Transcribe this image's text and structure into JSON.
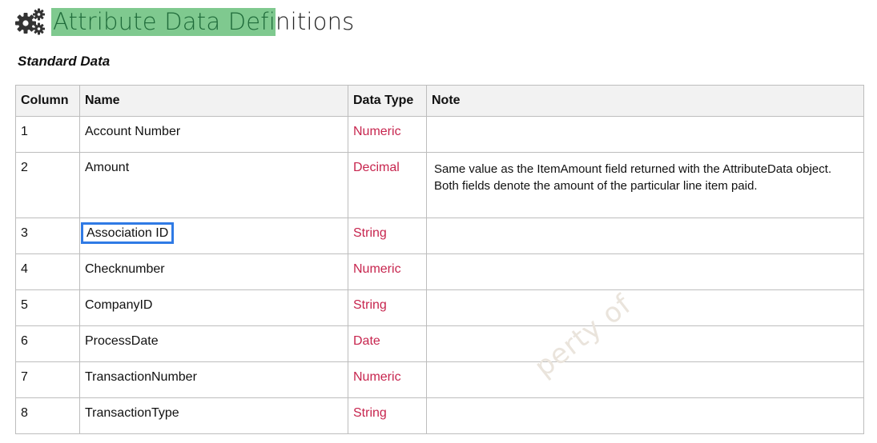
{
  "header": {
    "icon": "gears-icon",
    "title_highlight": "Attribute Data Defi",
    "title_rest": "nitions",
    "highlight_color": "#7fc98f"
  },
  "section": {
    "heading": "Standard Data"
  },
  "table": {
    "headers": {
      "column": "Column",
      "name": "Name",
      "data_type": "Data Type",
      "note": "Note"
    },
    "type_color": "#c7254e",
    "rows": [
      {
        "column": "1",
        "name": "Account Number",
        "data_type": "Numeric",
        "note": ""
      },
      {
        "column": "2",
        "name": "Amount",
        "data_type": "Decimal",
        "note": "Same value as the ItemAmount field returned with the AttributeData object. Both fields denote the amount of the particular line item paid."
      },
      {
        "column": "3",
        "name": "Association ID",
        "data_type": "String",
        "note": ""
      },
      {
        "column": "4",
        "name": "Checknumber",
        "data_type": "Numeric",
        "note": ""
      },
      {
        "column": "5",
        "name": "CompanyID",
        "data_type": "String",
        "note": ""
      },
      {
        "column": "6",
        "name": "ProcessDate",
        "data_type": "Date",
        "note": ""
      },
      {
        "column": "7",
        "name": "TransactionNumber",
        "data_type": "Numeric",
        "note": ""
      },
      {
        "column": "8",
        "name": "TransactionType",
        "data_type": "String",
        "note": ""
      }
    ]
  },
  "selection": {
    "selected_row": "3",
    "outline_color": "#2f7ae5"
  },
  "watermark": {
    "text": "perty of"
  }
}
